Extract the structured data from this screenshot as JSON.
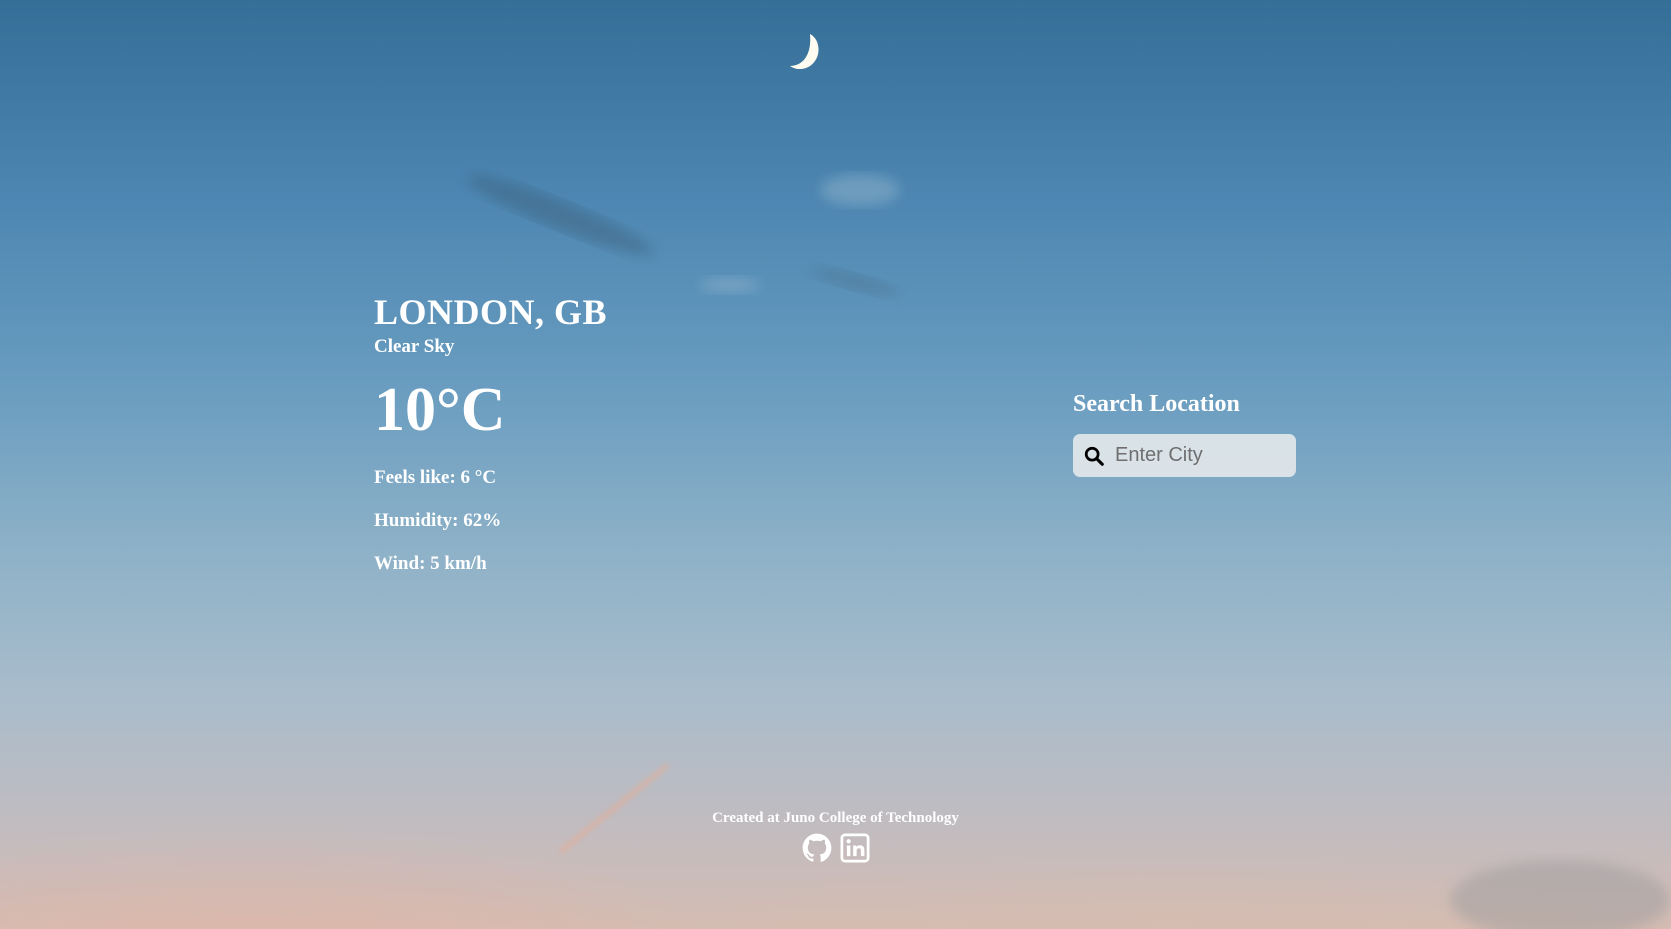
{
  "weather": {
    "city": "LONDON, GB",
    "description": "Clear Sky",
    "temperature": "10°C",
    "feels_like": "Feels like: 6 °C",
    "humidity": "Humidity: 62%",
    "wind": "Wind: 5 km/h"
  },
  "search": {
    "title": "Search Location",
    "placeholder": "Enter City",
    "value": ""
  },
  "footer": {
    "credit": "Created at Juno College of Technology",
    "links": [
      {
        "icon": "github-icon"
      },
      {
        "icon": "linkedin-icon"
      }
    ]
  },
  "colors": {
    "text": "#ffffff",
    "search_box": "#e2e7ea",
    "sky_top": "#356f98",
    "sky_bottom": "#d4bcb2"
  }
}
